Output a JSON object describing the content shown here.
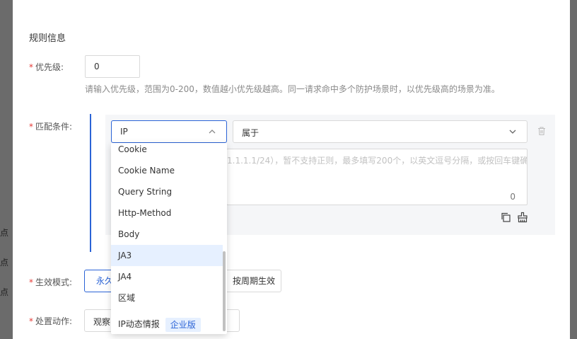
{
  "left_edge": [
    "点",
    "点",
    "点"
  ],
  "section_title": "规则信息",
  "priority": {
    "label": "优先级:",
    "required": "*",
    "value": "0",
    "hint": "请输入优先级，范围为0-200，数值越小优先级越高。同一请求命中多个防护场景时，以优先级高的场景为准。"
  },
  "match": {
    "label": "匹配条件:",
    "required": "*",
    "field_select": "IP",
    "operator_select": "属于",
    "textarea_placeholder_visible": "1.1.1.1/24），暂不支持正则，最多填写200个，以英文逗号分隔，或按回车键确",
    "counter": "0"
  },
  "dropdown": {
    "options": [
      "Cookie",
      "Cookie Name",
      "Query String",
      "Http-Method",
      "Body",
      "JA3",
      "JA4",
      "区域",
      "IP动态情报"
    ],
    "selected_index": 5,
    "badge": "企业版"
  },
  "effect_mode": {
    "label": "生效模式:",
    "required": "*",
    "option_permanent": "永久",
    "option_periodic": "按周期生效"
  },
  "action": {
    "label": "处置动作:",
    "required": "*",
    "value": "观察"
  },
  "colors": {
    "primary": "#2a63d6",
    "required": "#e53935",
    "selected_bg": "#e6f0ff"
  },
  "icons": [
    "trash-icon",
    "copy-icon",
    "clear-icon",
    "chevron-up-icon",
    "chevron-down-icon"
  ]
}
